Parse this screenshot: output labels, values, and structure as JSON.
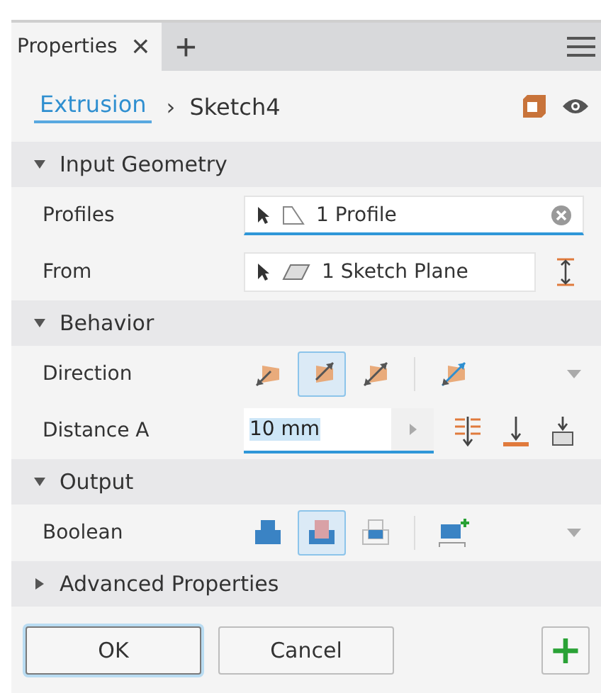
{
  "tabs": [
    {
      "label": "Properties",
      "selected": true,
      "close": "×"
    }
  ],
  "add_tab": "+",
  "breadcrumb": {
    "link": "Extrusion",
    "separator": "›",
    "current": "Sketch4"
  },
  "sections": [
    {
      "title": "Input Geometry",
      "expanded": true,
      "rows": [
        {
          "kind": "select",
          "label": "Profiles",
          "value": "1 Profile",
          "focused": true
        },
        {
          "kind": "select",
          "label": "From",
          "value": "1 Sketch Plane",
          "focused": false
        }
      ]
    },
    {
      "title": "Behavior",
      "expanded": true,
      "rows": [
        {
          "kind": "direction",
          "label": "Direction",
          "options": [
            {
              "selected": false
            },
            {
              "selected": true
            },
            {
              "selected": false
            },
            {
              "selected": false
            }
          ]
        },
        {
          "kind": "distance",
          "label": "Distance A",
          "value": "10 mm"
        }
      ]
    },
    {
      "title": "Output",
      "expanded": true,
      "rows": [
        {
          "kind": "boolean",
          "label": "Boolean",
          "options": [
            {
              "selected": false
            },
            {
              "selected": true
            },
            {
              "selected": false
            },
            {
              "selected": false
            }
          ]
        }
      ]
    },
    {
      "title": "Advanced Properties",
      "expanded": false
    }
  ],
  "buttons": [
    {
      "label": "OK",
      "default": true
    },
    {
      "label": "Cancel",
      "default": false
    }
  ],
  "apply_button": "+"
}
